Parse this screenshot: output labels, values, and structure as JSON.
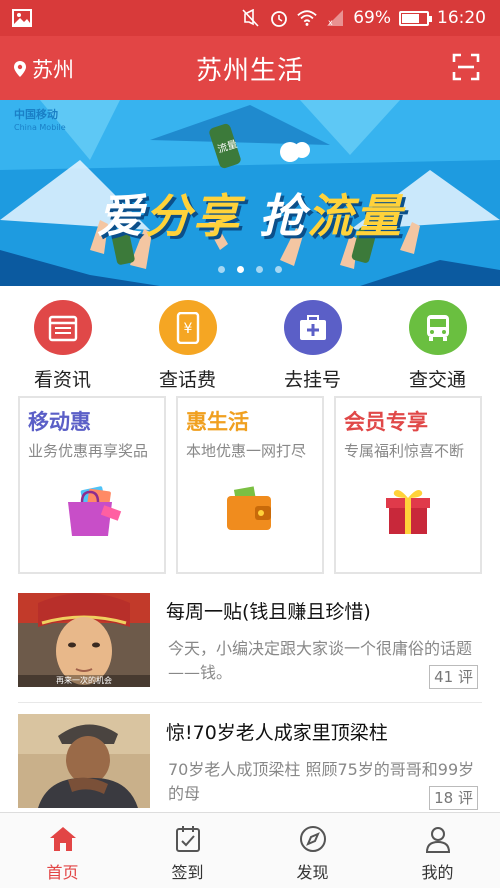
{
  "status_bar": {
    "battery": "69%",
    "battery_level": 0.69,
    "time": "16:20"
  },
  "header": {
    "location": "苏州",
    "title": "苏州生活",
    "scan_icon": "scan-icon"
  },
  "banner": {
    "logo_cn": "中国移动",
    "logo_en": "China Mobile",
    "headline_a": "爱",
    "headline_b": "分享",
    "headline_c": "抢",
    "headline_d": "流量",
    "bottle_label": "流量",
    "slide_count": 4,
    "active_slide": 1
  },
  "actions": [
    {
      "label": "看资讯",
      "icon": "news-icon",
      "color": "#e04848"
    },
    {
      "label": "查话费",
      "icon": "phone-bill-icon",
      "color": "#f5a623"
    },
    {
      "label": "去挂号",
      "icon": "hospital-icon",
      "color": "#5b5fc7"
    },
    {
      "label": "查交通",
      "icon": "bus-icon",
      "color": "#6abf40"
    }
  ],
  "cards": [
    {
      "title": "移动惠",
      "desc": "业务优惠再享奖品",
      "color": "#5b5fc7",
      "icon": "shopping-bag-icon"
    },
    {
      "title": "惠生活",
      "desc": "本地优惠一网打尽",
      "color": "#f0a020",
      "icon": "wallet-icon"
    },
    {
      "title": "会员专享",
      "desc": "专属福利惊喜不断",
      "color": "#e04848",
      "icon": "gift-icon"
    }
  ],
  "articles": [
    {
      "title": "每周一贴(钱且赚且珍惜)",
      "summary": "今天，小编决定跟大家谈一个很庸俗的话题——钱。",
      "comments": "41 评",
      "thumb_caption": "再来一次的机会"
    },
    {
      "title": "惊!70岁老人成家里顶梁柱",
      "summary": "70岁老人成顶梁柱 照顾75岁的哥哥和99岁的母",
      "comments": "18 评"
    }
  ],
  "nav": [
    {
      "label": "首页",
      "icon": "home-icon",
      "active": true
    },
    {
      "label": "签到",
      "icon": "checkin-icon",
      "active": false
    },
    {
      "label": "发现",
      "icon": "compass-icon",
      "active": false
    },
    {
      "label": "我的",
      "icon": "profile-icon",
      "active": false
    }
  ]
}
